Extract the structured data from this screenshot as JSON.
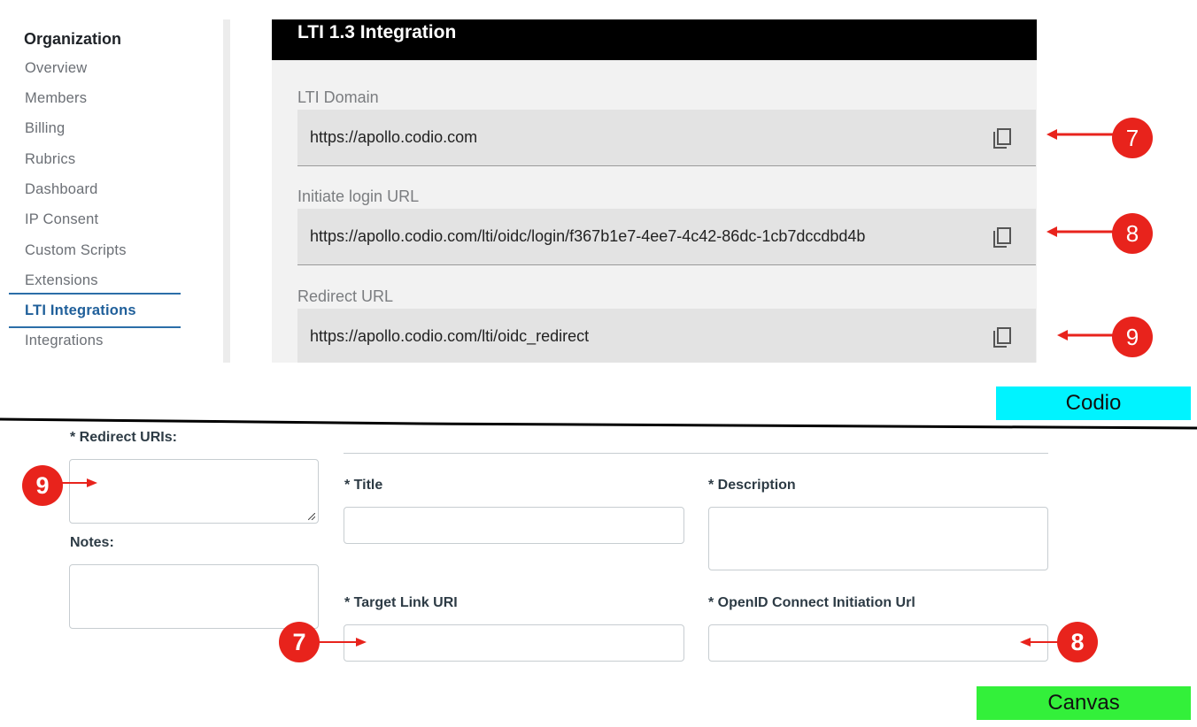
{
  "codio": {
    "sidebar": {
      "title": "Organization",
      "items": [
        {
          "label": "Overview"
        },
        {
          "label": "Members"
        },
        {
          "label": "Billing"
        },
        {
          "label": "Rubrics"
        },
        {
          "label": "Dashboard"
        },
        {
          "label": "IP Consent"
        },
        {
          "label": "Custom Scripts"
        },
        {
          "label": "Extensions"
        },
        {
          "label": "LTI Integrations",
          "active": true
        },
        {
          "label": "Integrations"
        }
      ]
    },
    "panel": {
      "title": "LTI 1.3 Integration",
      "fields": [
        {
          "label": "LTI Domain",
          "value": "https://apollo.codio.com",
          "icon": "copy-icon"
        },
        {
          "label": "Initiate login URL",
          "value": "https://apollo.codio.com/lti/oidc/login/f367b1e7-4ee7-4c42-86dc-1cb7dccdbd4b",
          "icon": "copy-icon"
        },
        {
          "label": "Redirect URL",
          "value": "https://apollo.codio.com/lti/oidc_redirect",
          "icon": "copy-icon"
        }
      ]
    },
    "tag": "Codio"
  },
  "canvas": {
    "redirect_uris_label": "* Redirect URIs:",
    "notes_label": "Notes:",
    "title_label": "* Title",
    "description_label": "* Description",
    "target_link_label": "* Target Link URI",
    "openid_label": "* OpenID Connect Initiation Url",
    "tag": "Canvas"
  },
  "annotations": {
    "codio_badges": [
      "7",
      "8",
      "9"
    ],
    "canvas_badges": [
      "9",
      "7",
      "8"
    ],
    "color": "#e8231c"
  },
  "colors": {
    "codio_tag_bg": "#00f3ff",
    "canvas_tag_bg": "#33f03a",
    "active_nav": "#1f5f9a",
    "panel_header": "#000000"
  }
}
